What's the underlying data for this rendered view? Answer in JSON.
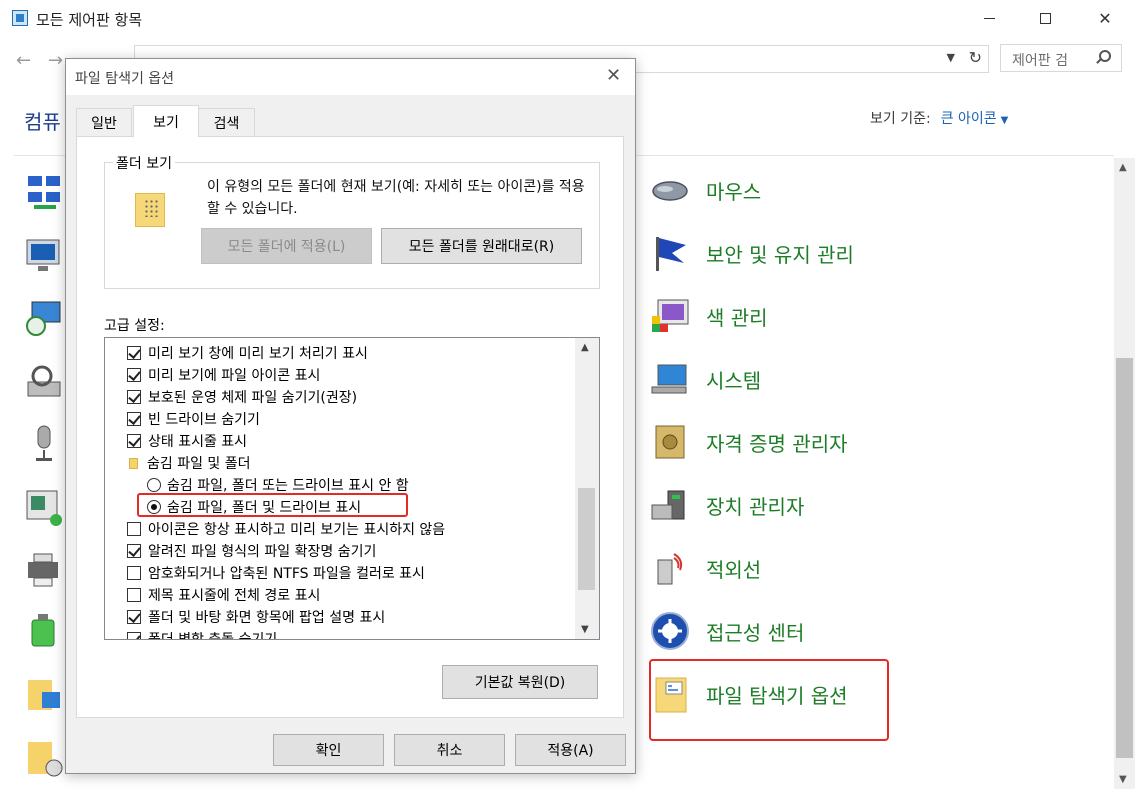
{
  "window": {
    "title": "모든 제어판 항목"
  },
  "search": {
    "placeholder": "제어판 검"
  },
  "heading": "컴퓨",
  "viewby": {
    "label": "보기 기준:",
    "value": "큰 아이콘"
  },
  "items": [
    {
      "label": "마우스",
      "icon": "mouse-icon"
    },
    {
      "label": "보안 및 유지 관리",
      "icon": "flag-icon"
    },
    {
      "label": "색 관리",
      "icon": "color-management-icon"
    },
    {
      "label": "시스템",
      "icon": "system-icon"
    },
    {
      "label": "자격 증명 관리자",
      "icon": "credential-vault-icon"
    },
    {
      "label": "장치 관리자",
      "icon": "device-manager-icon"
    },
    {
      "label": "적외선",
      "icon": "infrared-icon"
    },
    {
      "label": "접근성 센터",
      "icon": "ease-of-access-icon"
    },
    {
      "label": "파일 탐색기 옵션",
      "icon": "folder-options-icon"
    }
  ],
  "dialog": {
    "title": "파일 탐색기 옵션",
    "tabs": [
      "일반",
      "보기",
      "검색"
    ],
    "active_tab": "보기",
    "folder_view": {
      "title": "폴더 보기",
      "description": "이 유형의 모든 폴더에 현재 보기(예: 자세히 또는 아이콘)를 적용할 수 있습니다.",
      "apply_button": "모든 폴더에 적용(L)",
      "reset_button": "모든 폴더를 원래대로(R)"
    },
    "advanced_label": "고급 설정:",
    "advanced": [
      {
        "type": "checkbox",
        "checked": true,
        "label": "미리 보기 창에 미리 보기 처리기 표시"
      },
      {
        "type": "checkbox",
        "checked": true,
        "label": "미리 보기에 파일 아이콘 표시"
      },
      {
        "type": "checkbox",
        "checked": true,
        "label": "보호된 운영 체제 파일 숨기기(권장)"
      },
      {
        "type": "checkbox",
        "checked": true,
        "label": "빈 드라이브 숨기기"
      },
      {
        "type": "checkbox",
        "checked": true,
        "label": "상태 표시줄 표시"
      },
      {
        "type": "folder",
        "label": "숨김 파일 및 폴더"
      },
      {
        "type": "radio",
        "checked": false,
        "label": "숨김 파일, 폴더 또는 드라이브 표시 안 함"
      },
      {
        "type": "radio",
        "checked": true,
        "label": "숨김 파일, 폴더 및 드라이브 표시"
      },
      {
        "type": "checkbox",
        "checked": false,
        "label": "아이콘은 항상 표시하고 미리 보기는 표시하지 않음"
      },
      {
        "type": "checkbox",
        "checked": true,
        "label": "알려진 파일 형식의 파일 확장명 숨기기"
      },
      {
        "type": "checkbox",
        "checked": false,
        "label": "암호화되거나 압축된 NTFS 파일을 컬러로 표시"
      },
      {
        "type": "checkbox",
        "checked": false,
        "label": "제목 표시줄에 전체 경로 표시"
      },
      {
        "type": "checkbox",
        "checked": true,
        "label": "폴더 및 바탕 화면 항목에 팝업 설명 표시"
      },
      {
        "type": "checkbox",
        "checked": true,
        "label": "폴더 병합 충돌 숨기기"
      }
    ],
    "restore_defaults": "기본값 복원(D)",
    "ok": "확인",
    "cancel": "취소",
    "apply": "적용(A)"
  },
  "colors": {
    "accent": "#1a63b5",
    "item_label": "#1d7d27",
    "highlight": "#e42a24"
  }
}
